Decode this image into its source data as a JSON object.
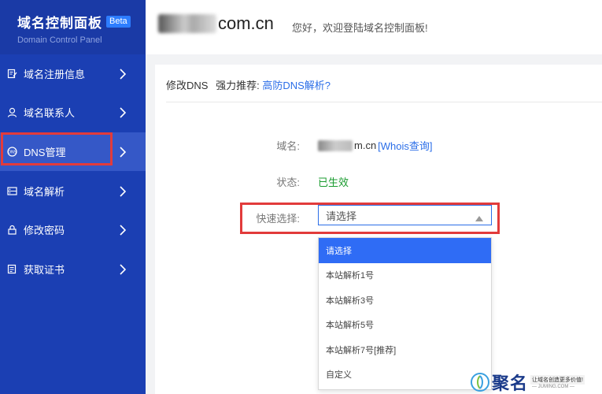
{
  "sidebar": {
    "title": "域名控制面板",
    "badge": "Beta",
    "subtitle": "Domain Control Panel",
    "items": [
      {
        "label": "域名注册信息",
        "icon": "edit-document-icon"
      },
      {
        "label": "域名联系人",
        "icon": "user-icon"
      },
      {
        "label": "DNS管理",
        "icon": "dns-icon",
        "active": true
      },
      {
        "label": "域名解析",
        "icon": "server-icon"
      },
      {
        "label": "修改密码",
        "icon": "lock-icon"
      },
      {
        "label": "获取证书",
        "icon": "certificate-icon"
      }
    ]
  },
  "header": {
    "domain_suffix": "com.cn",
    "welcome": "您好，欢迎登陆域名控制面板!"
  },
  "breadcrumb": {
    "current": "修改DNS",
    "recommend_label": "强力推荐:",
    "recommend_link": "高防DNS解析?"
  },
  "form": {
    "domain_label": "域名:",
    "domain_suffix": "m.cn",
    "whois_link": "[Whois查询]",
    "status_label": "状态:",
    "status_value": "已生效",
    "quick_select_label": "快速选择:",
    "quick_select_value": "请选择",
    "options": [
      "请选择",
      "本站解析1号",
      "本站解析3号",
      "本站解析5号",
      "本站解析7号[推荐]",
      "自定义"
    ]
  },
  "watermark": {
    "brand": "聚名",
    "slogan": "让域名创造更多价值!",
    "site": "— JUMING.COM —"
  },
  "colors": {
    "sidebar_bg": "#1b3fb3",
    "accent": "#2b6ee8",
    "highlight": "#e23b3b",
    "status_ok": "#1a9b2f"
  }
}
